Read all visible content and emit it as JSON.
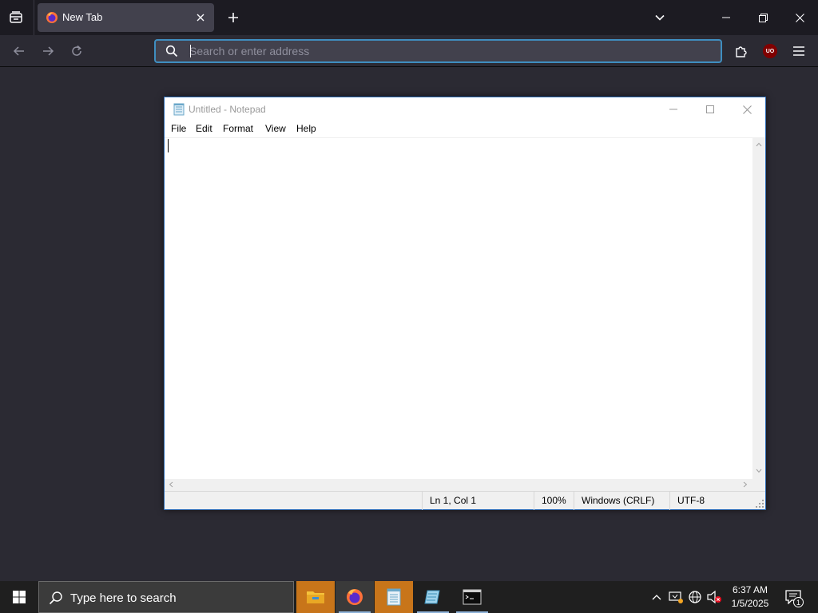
{
  "firefox": {
    "tab": {
      "title": "New Tab"
    },
    "urlbar": {
      "placeholder": "Search or enter address",
      "value": ""
    },
    "extension_badge": "UO"
  },
  "notepad": {
    "title": "Untitled - Notepad",
    "menu": [
      "File",
      "Edit",
      "Format",
      "View",
      "Help"
    ],
    "content": "",
    "status": {
      "position": "Ln 1, Col 1",
      "zoom": "100%",
      "line_ending": "Windows (CRLF)",
      "encoding": "UTF-8"
    }
  },
  "taskbar": {
    "search_placeholder": "Type here to search",
    "apps": [
      "file-explorer",
      "firefox",
      "notepad-app",
      "notepad",
      "terminal"
    ],
    "clock": {
      "time": "6:37 AM",
      "date": "1/5/2025"
    },
    "notification_count": "1"
  },
  "colors": {
    "tabstrip_bg": "#1c1b22",
    "toolbar_bg": "#2b2a33",
    "urlbar_focus": "#3f8ec0",
    "taskbar_bg": "#1f1f1f",
    "taskbar_active_app": "#c8751a"
  }
}
